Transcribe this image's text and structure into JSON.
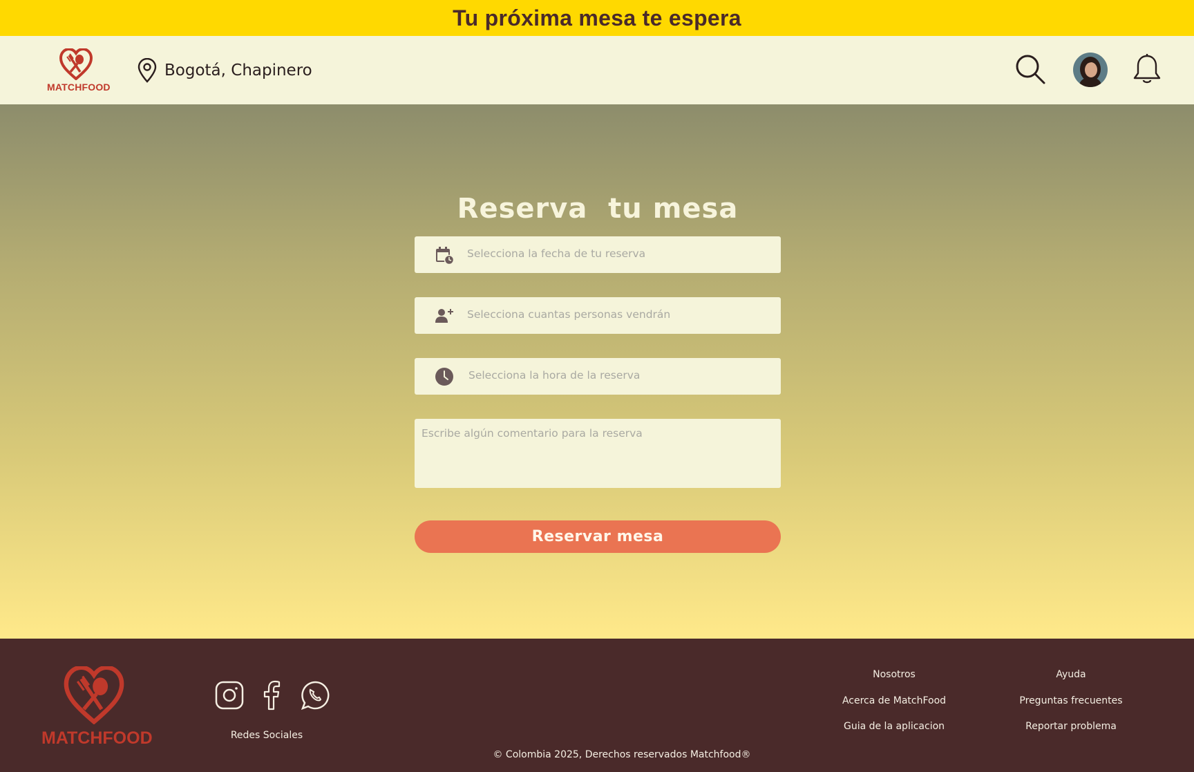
{
  "banner": {
    "text": "Tu próxima mesa te espera"
  },
  "header": {
    "logo_text": "MATCHFOOD",
    "location": "Bogotá, Chapinero"
  },
  "reservation": {
    "title": "Reserva  tu mesa",
    "date_placeholder": "Selecciona la fecha de tu reserva",
    "people_placeholder": "Selecciona cuantas personas vendrán",
    "time_placeholder": "Selecciona la hora de la reserva",
    "comment_placeholder": "Escribe algún comentario para la reserva",
    "submit_label": "Reservar mesa"
  },
  "footer": {
    "logo_text": "MATCHFOOD",
    "social_label": "Redes Sociales",
    "col1": [
      "Nosotros",
      "Acerca de MatchFood",
      "Guia de la aplicacion"
    ],
    "col2": [
      "Ayuda",
      "Preguntas frecuentes",
      "Reportar problema"
    ],
    "copyright": "© Colombia 2025, Derechos reservados Matchfood®"
  },
  "colors": {
    "banner": "#ffd900",
    "header_bg": "#f5f4da",
    "accent_button": "#ea7452",
    "footer_bg": "#4a2a2a",
    "brand_red": "#c0392b"
  }
}
